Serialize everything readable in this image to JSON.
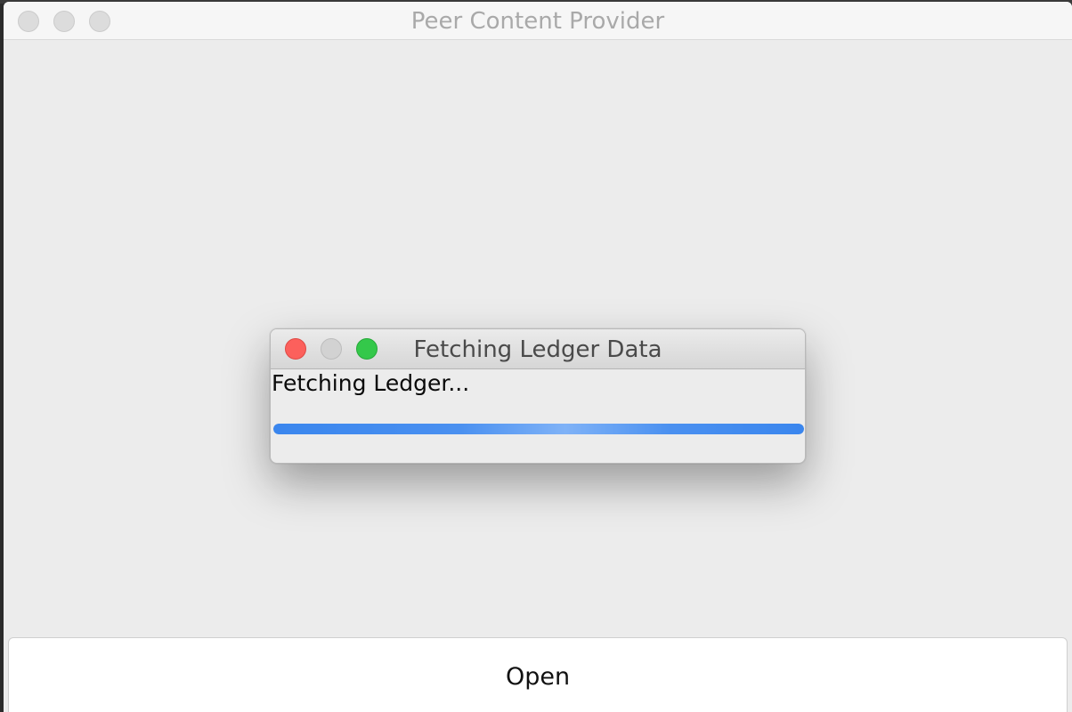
{
  "main_window": {
    "title": "Peer Content Provider",
    "open_button_label": "Open"
  },
  "dialog": {
    "title": "Fetching Ledger Data",
    "message": "Fetching Ledger...",
    "progress": 1.0
  },
  "colors": {
    "close": "#fc605c",
    "zoom": "#34c84a",
    "progress": "#3a86ee"
  }
}
